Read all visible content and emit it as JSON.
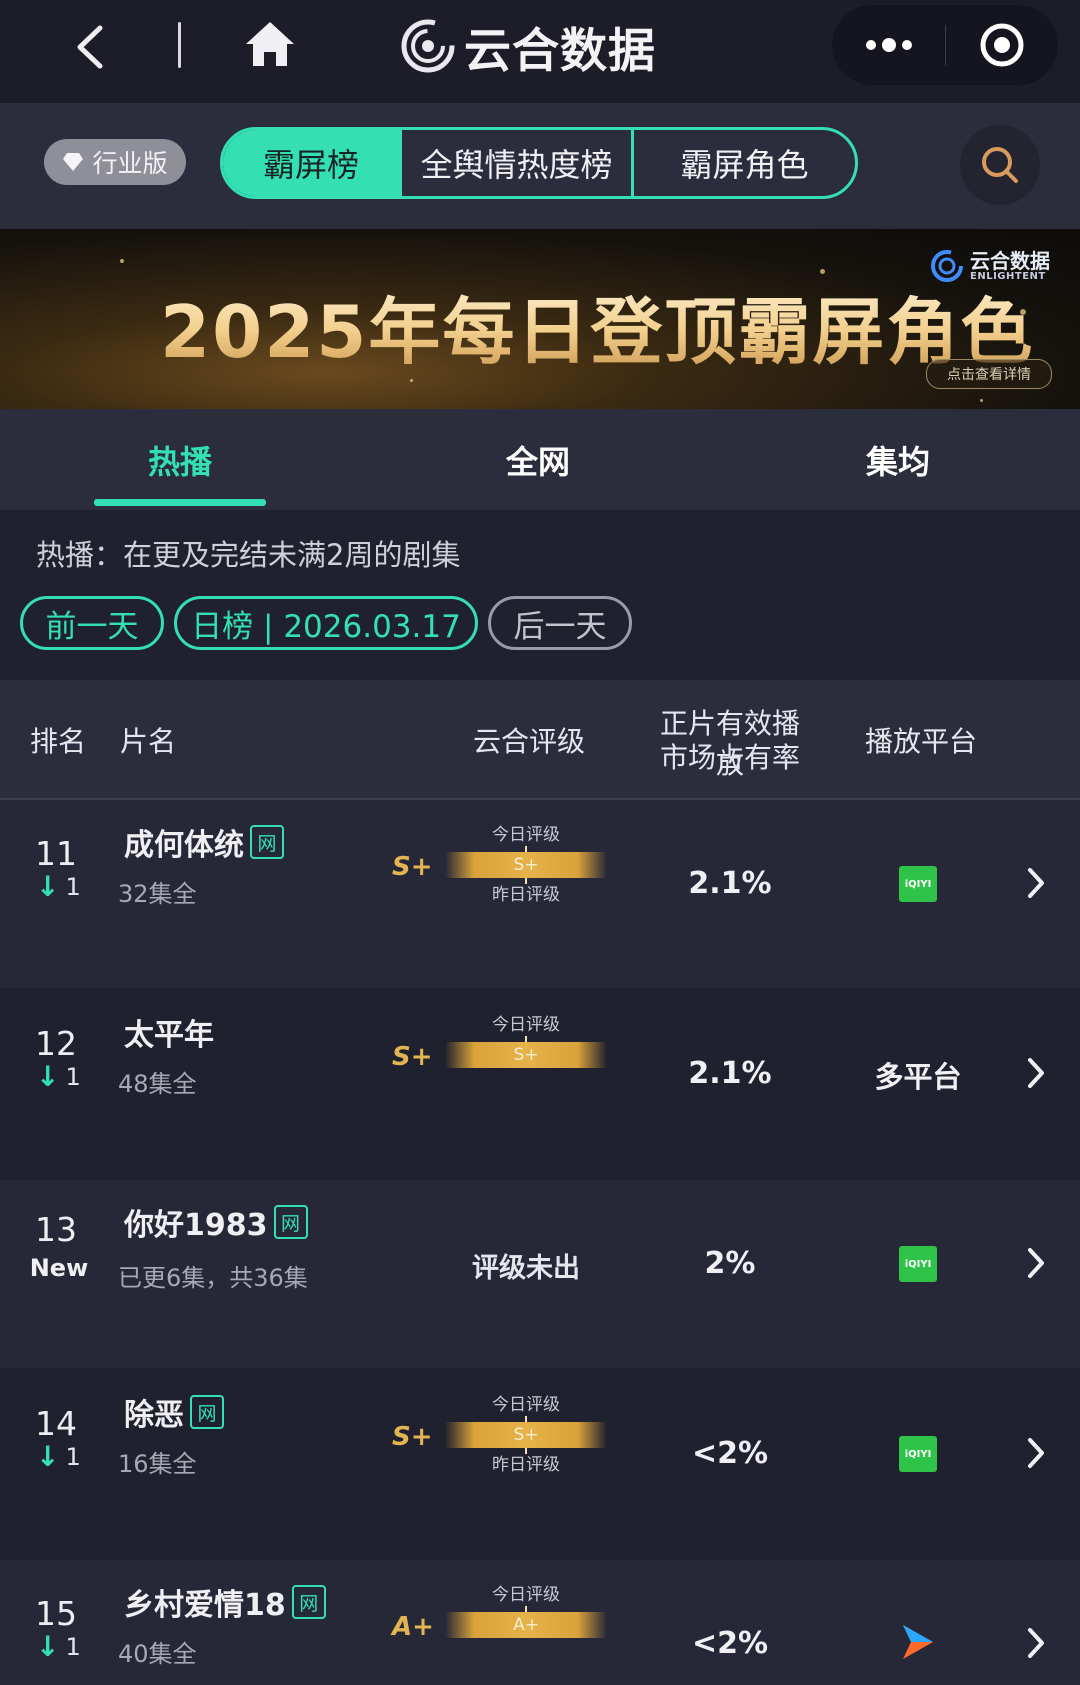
{
  "app": {
    "title": "云合数据"
  },
  "header": {
    "badge_label": "行业版",
    "tabs": [
      {
        "label": "霸屏榜",
        "active": true
      },
      {
        "label": "全舆情热度榜",
        "active": false
      },
      {
        "label": "霸屏角色",
        "active": false
      }
    ]
  },
  "banner": {
    "title": "2025年每日登顶霸屏角色",
    "logo_cn": "云合数据",
    "logo_en": "ENLIGHTENT",
    "detail_label": "点击查看详情"
  },
  "subtabs": [
    {
      "label": "热播",
      "active": true
    },
    {
      "label": "全网",
      "active": false
    },
    {
      "label": "集均",
      "active": false
    }
  ],
  "description": "热播：在更及完结未满2周的剧集",
  "date_nav": {
    "prev_label": "前一天",
    "current_label": "日榜 | 2026.03.17",
    "next_label": "后一天"
  },
  "table": {
    "headers": {
      "rank": "排名",
      "title": "片名",
      "grade": "云合评级",
      "share_line1": "正片有效播放",
      "share_line2": "市场占有率",
      "platform": "播放平台"
    },
    "today_label": "今日评级",
    "yesterday_label": "昨日评级",
    "rows": [
      {
        "rank": "11",
        "change": "1",
        "title": "成何体统",
        "net_tag": "网",
        "episodes": "32集全",
        "grade": "S+",
        "bar": "S+",
        "share": "2.1%",
        "platform_icon": "iqiyi-icon",
        "platform_text": "iQIYI"
      },
      {
        "rank": "12",
        "change": "1",
        "title": "太平年",
        "episodes": "48集全",
        "grade": "S+",
        "bar": "S+",
        "share": "2.1%",
        "platform_text": "多平台"
      },
      {
        "rank": "13",
        "new_label": "New",
        "title": "你好1983",
        "net_tag": "网",
        "episodes": "已更6集，共36集",
        "unrated": "评级未出",
        "share": "2%",
        "platform_icon": "iqiyi-icon",
        "platform_text": "iQIYI"
      },
      {
        "rank": "14",
        "change": "1",
        "title": "除恶",
        "net_tag": "网",
        "episodes": "16集全",
        "grade": "S+",
        "bar": "S+",
        "share": "<2%",
        "platform_icon": "iqiyi-icon",
        "platform_text": "iQIYI"
      },
      {
        "rank": "15",
        "change": "1",
        "title": "乡村爱情18",
        "net_tag": "网",
        "episodes": "40集全",
        "grade": "A+",
        "bar": "A+",
        "share": "<2%",
        "platform_icon": "youku-icon"
      }
    ]
  },
  "colors": {
    "accent": "#34e0b2",
    "gold": "#e3b552",
    "background": "#20212e",
    "iqiyi": "#2fc34a"
  }
}
